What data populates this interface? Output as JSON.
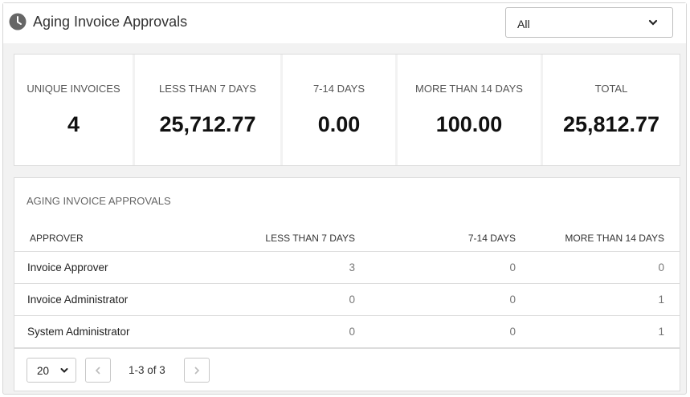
{
  "header": {
    "title": "Aging Invoice Approvals",
    "filter": {
      "selected": "All"
    }
  },
  "stats": [
    {
      "label": "UNIQUE INVOICES",
      "value": "4"
    },
    {
      "label": "LESS THAN 7 DAYS",
      "value": "25,712.77"
    },
    {
      "label": "7-14 DAYS",
      "value": "0.00"
    },
    {
      "label": "MORE THAN 14 DAYS",
      "value": "100.00"
    },
    {
      "label": "TOTAL",
      "value": "25,812.77"
    }
  ],
  "table": {
    "title": "AGING INVOICE APPROVALS",
    "columns": [
      "APPROVER",
      "LESS THAN 7 DAYS",
      "7-14 DAYS",
      "MORE THAN 14 DAYS"
    ],
    "rows": [
      [
        "Invoice Approver",
        "3",
        "0",
        "0"
      ],
      [
        "Invoice Administrator",
        "0",
        "0",
        "1"
      ],
      [
        "System Administrator",
        "0",
        "0",
        "1"
      ]
    ]
  },
  "pagination": {
    "page_size": "20",
    "range_text": "1-3 of 3"
  },
  "colors": {
    "background": "#f2f2f2",
    "card": "#ffffff",
    "border": "#dcdcdc",
    "icon": "#666666"
  },
  "icons": [
    "clock-icon",
    "chevron-down-icon",
    "chevron-left-icon",
    "chevron-right-icon"
  ]
}
